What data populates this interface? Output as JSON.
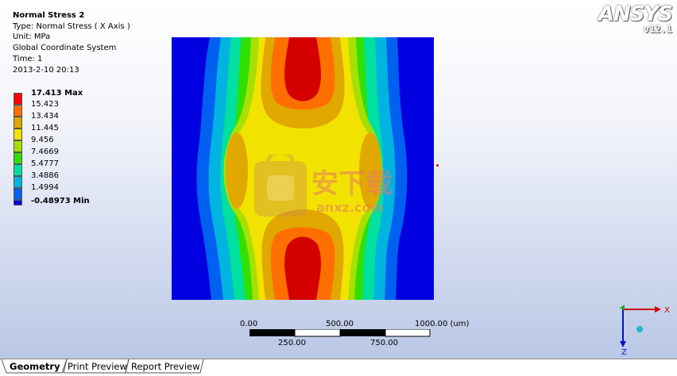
{
  "result_info": {
    "title": "Normal Stress 2",
    "type": "Type: Normal Stress ( X Axis )",
    "unit": "Unit: MPa",
    "coordinate_system": "Global Coordinate System",
    "time": "Time: 1",
    "timestamp": "2013-2-10 20:13"
  },
  "legend": [
    {
      "label": "17.413 Max",
      "color": "#ff0000",
      "bold": true
    },
    {
      "label": "15.423",
      "color": "#ff6f00"
    },
    {
      "label": "13.434",
      "color": "#e0a800"
    },
    {
      "label": "11.445",
      "color": "#f2e200"
    },
    {
      "label": "9.456",
      "color": "#a7e000"
    },
    {
      "label": "7.4669",
      "color": "#2fe000"
    },
    {
      "label": "5.4777",
      "color": "#00e0a0"
    },
    {
      "label": "3.4886",
      "color": "#00b4e0"
    },
    {
      "label": "1.4994",
      "color": "#0060f0"
    },
    {
      "label": "-0.48973 Min",
      "color": "#0000e0",
      "bold": true
    }
  ],
  "logo": {
    "brand": "ANSYS",
    "version": "v12.1"
  },
  "scale_bar": {
    "top_labels": [
      "0.00",
      "500.00",
      "1000.00 (um)"
    ],
    "bottom_labels": [
      "250.00",
      "750.00"
    ]
  },
  "triad": {
    "x": "X",
    "z": "Z"
  },
  "watermark": {
    "text": "安下载",
    "domain": "anxz.com"
  },
  "tabs": [
    "Geometry",
    "Print Preview",
    "Report Preview"
  ],
  "colors": {
    "accent_red": "#cc0000",
    "blue": "#0016d4"
  }
}
